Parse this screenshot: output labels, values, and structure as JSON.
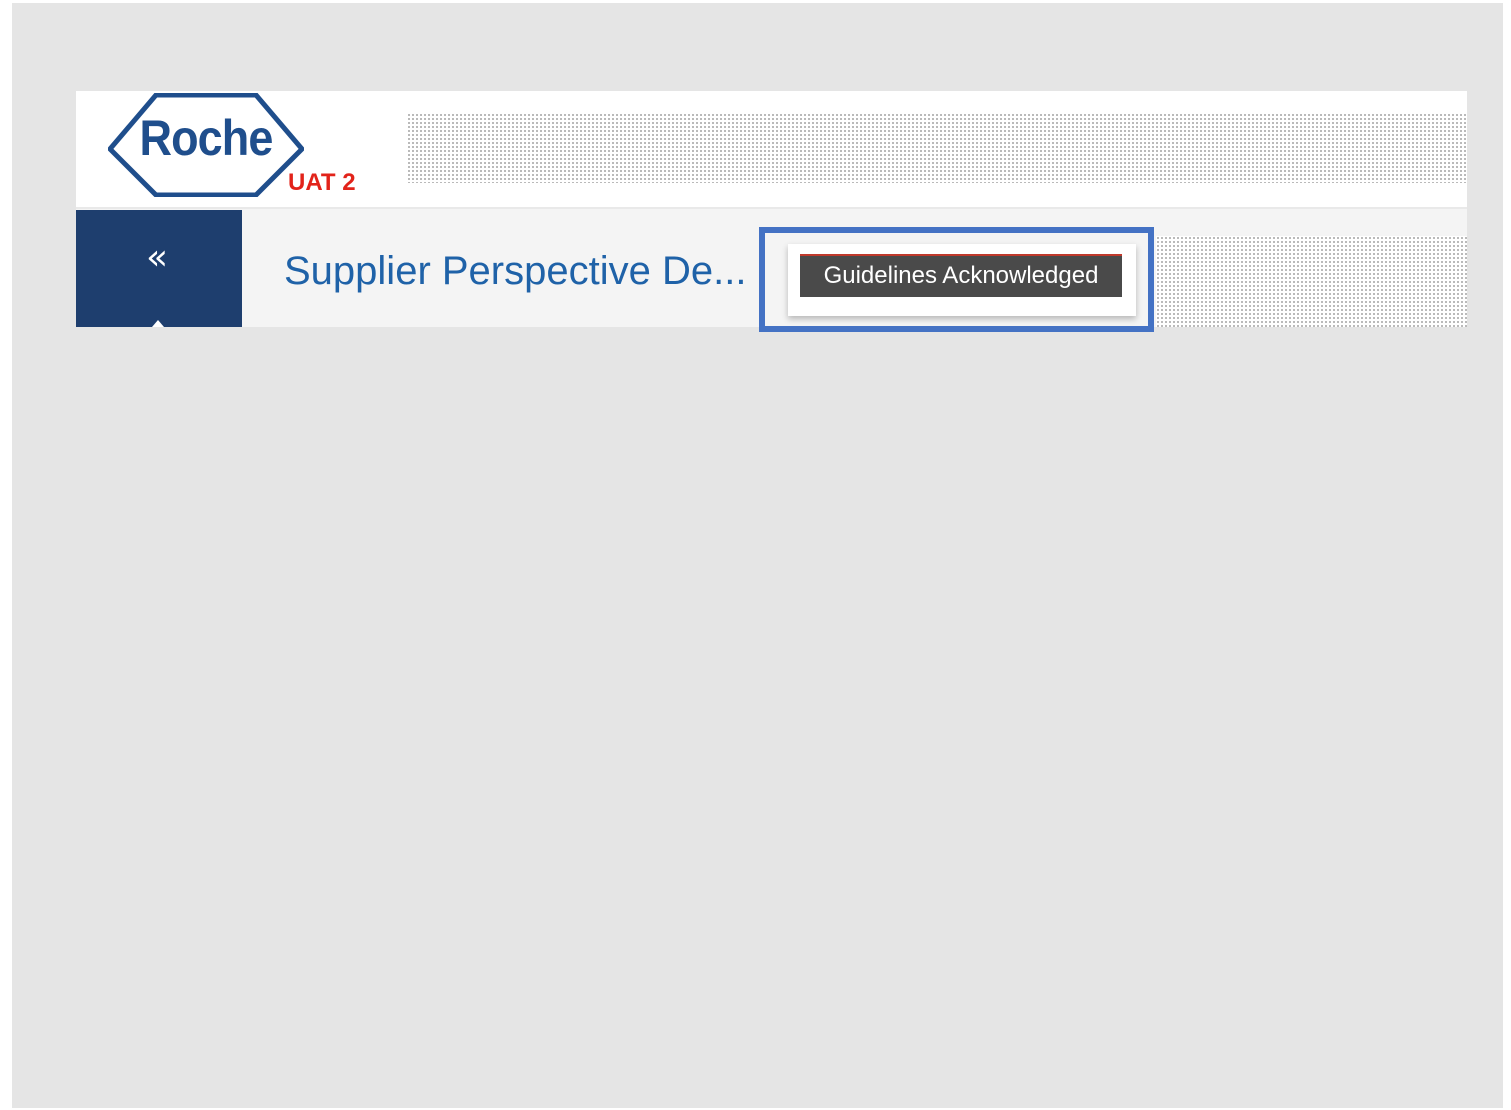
{
  "header": {
    "logo_text": "Roche",
    "environment_label": "UAT 2"
  },
  "sidebar_toggle": {
    "icon": "double-chevron-left-icon",
    "glyph": "«"
  },
  "page": {
    "title": "Supplier Perspective De..."
  },
  "status_button": {
    "label": "Guidelines Acknowledged"
  },
  "colors": {
    "slide_background": "#e5e5e5",
    "brand_blue": "#1f4e8c",
    "sidebar_navy": "#1e3e6e",
    "title_blue": "#1f62a8",
    "environment_red": "#e2231a",
    "button_gray": "#4a4a4a",
    "highlight_blue": "#4472c4"
  }
}
